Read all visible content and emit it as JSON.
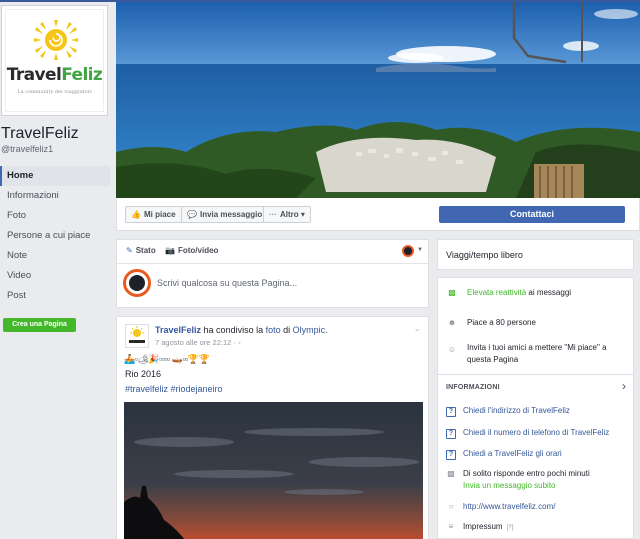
{
  "page": {
    "name": "TravelFeliz",
    "handle": "@travelfeliz1",
    "logo": {
      "word_main": "Travel",
      "word_accent": "Feliz",
      "tagline": "La community dei viaggiatori"
    }
  },
  "sidebar": {
    "items": [
      {
        "label": "Home",
        "active": true
      },
      {
        "label": "Informazioni"
      },
      {
        "label": "Foto"
      },
      {
        "label": "Persone a cui piace"
      },
      {
        "label": "Note"
      },
      {
        "label": "Video"
      },
      {
        "label": "Post"
      }
    ],
    "create_page": "Crea una Pagina"
  },
  "actions": {
    "like": "Mi piace",
    "message": "Invia messaggio",
    "more": "Altro",
    "contact": "Contattaci"
  },
  "composer": {
    "tab_status": "Stato",
    "tab_photo": "Foto/video",
    "placeholder": "Scrivi qualcosa su questa Pagina..."
  },
  "post": {
    "author": "TravelFeliz",
    "shared_text": "ha condiviso la",
    "photo_link": "foto",
    "of_text": "di",
    "source": "Olympic.",
    "time": "7 agosto alle ore 22:12 · ",
    "emoji_line": "🚣▫🏕🎉▫▫▫▫ 🛶▫▫🏆🏆",
    "text": "Rio 2016",
    "hashtags": "#travelfeliz #riodejaneiro"
  },
  "right": {
    "category": "Viaggi/tempo libero",
    "stats": {
      "responsiveness": "Elevata reattività",
      "responsiveness_rest": " ai messaggi",
      "likes": "Piace a 80 persone",
      "invite": "Invita i tuoi amici a mettere \"Mi piace\" a questa Pagina"
    },
    "info": {
      "title": "INFORMAZIONI",
      "ask_address": "Chiedi l'indirizzo di TravelFeliz",
      "ask_phone": "Chiedi il numero di telefono di TravelFeliz",
      "ask_hours": "Chiedi a TravelFeliz gli orari",
      "responds": "Di solito risponde entro pochi minuti",
      "send_message": "Invia un messaggio subito",
      "website": "http://www.travelfeliz.com/",
      "impressum": "Impressum",
      "impressum_note": "[?]"
    }
  },
  "colors": {
    "brand": "#4267b2",
    "green": "#42b72a",
    "link": "#365899",
    "background": "#e9ebee"
  }
}
